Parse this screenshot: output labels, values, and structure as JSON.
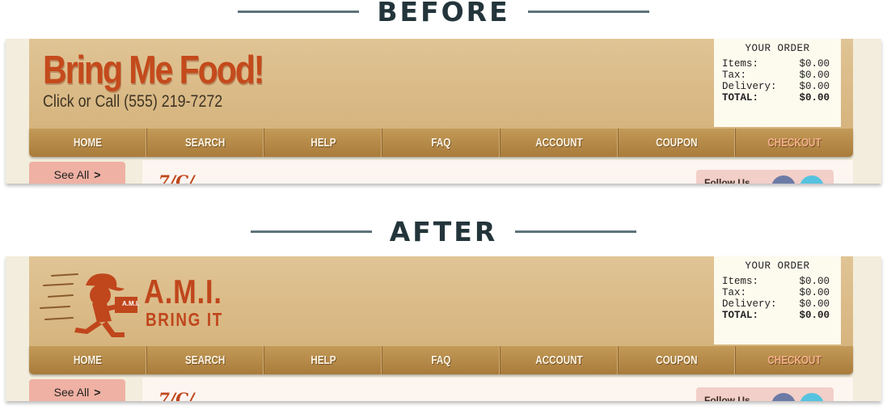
{
  "before_heading": "BEFORE",
  "after_heading": "AFTER",
  "before": {
    "brand_title": "Bring Me Food!",
    "brand_phone": "Click or Call (555) 219-7272"
  },
  "after": {
    "logo_text": "A.M.I.",
    "logo_tagline": "BRING IT",
    "logo_box_label": "A.M.I."
  },
  "receipt": {
    "title": "YOUR ORDER",
    "rows": [
      {
        "label": "Items:",
        "value": "$0.00"
      },
      {
        "label": "Tax:",
        "value": "$0.00"
      },
      {
        "label": "Delivery:",
        "value": "$0.00"
      },
      {
        "label": "TOTAL:",
        "value": "$0.00"
      }
    ]
  },
  "nav": [
    "HOME",
    "SEARCH",
    "HELP",
    "FAQ",
    "ACCOUNT",
    "COUPON",
    "CHECKOUT"
  ],
  "see_all": {
    "label": "See All",
    "chevron": ">"
  },
  "content": {
    "script_text": "7/C/",
    "follow_text": "Follow Us"
  },
  "colors": {
    "brand_red": "#c44a1c",
    "header_tan": "#dcbf8c",
    "nav_brown": "#b38645",
    "checkout_accent": "#f4b08a",
    "see_all_pink": "#efb1a3",
    "heading_slate": "#23353b",
    "facebook": "#6c7aa6",
    "twitter": "#55c3df"
  },
  "icons": [
    "runner-mascot-icon",
    "facebook-icon",
    "twitter-icon"
  ]
}
